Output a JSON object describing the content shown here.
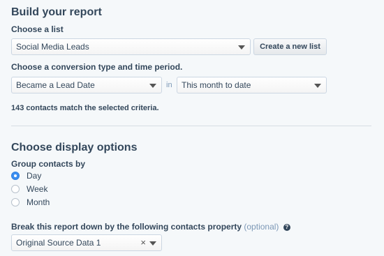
{
  "report": {
    "title": "Build your report",
    "choose_list_label": "Choose a list",
    "list_selected": "Social Media Leads",
    "create_list_button": "Create a new list",
    "conversion_label": "Choose a conversion type and time period.",
    "conversion_type": "Became a Lead Date",
    "in_label": "in",
    "time_period": "This month to date",
    "match_text": "143 contacts match the selected criteria."
  },
  "display": {
    "title": "Choose display options",
    "group_label": "Group contacts by",
    "group_options": [
      {
        "label": "Day",
        "checked": true
      },
      {
        "label": "Week",
        "checked": false
      },
      {
        "label": "Month",
        "checked": false
      }
    ],
    "breakdown_label": "Break this report down by the following contacts property",
    "breakdown_optional": "(optional)",
    "breakdown_value": "Original Source Data 1",
    "clear_symbol": "×"
  }
}
